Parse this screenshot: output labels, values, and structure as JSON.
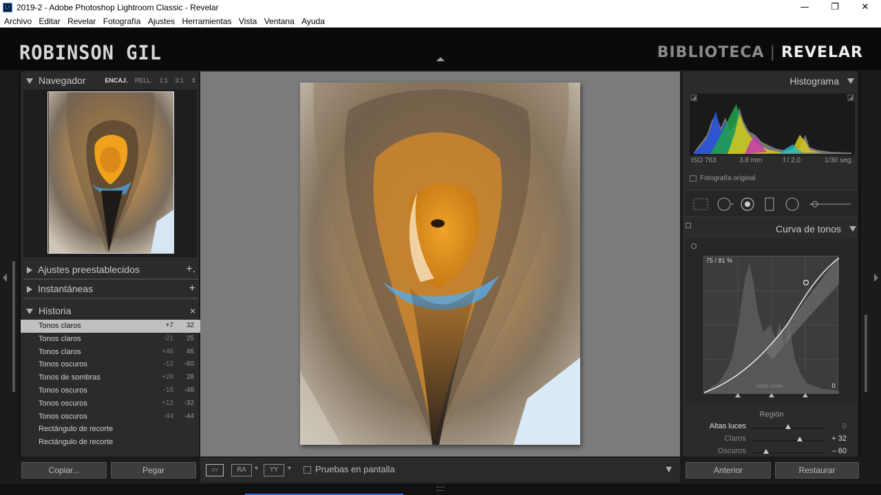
{
  "window": {
    "title": "2019-2 - Adobe Photoshop Lightroom Classic - Revelar",
    "app_icon": "Lr",
    "minimize": "—",
    "maximize": "❐",
    "close": "✕"
  },
  "menu": [
    "Archivo",
    "Editar",
    "Revelar",
    "Fotografía",
    "Ajustes",
    "Herramientas",
    "Vista",
    "Ventana",
    "Ayuda"
  ],
  "identity": {
    "brand": "ROBINSON GIL",
    "modules": {
      "library": "BIBLIOTECA",
      "separator": "|",
      "develop": "REVELAR"
    }
  },
  "navigator": {
    "title": "Navegador",
    "zoom": [
      "ENCAJ.",
      "RELL.",
      "1:1",
      "3:1"
    ],
    "zoom_arrow": "⇕"
  },
  "left_panels": {
    "presets": {
      "title": "Ajustes preestablecidos",
      "action": "+."
    },
    "snapshots": {
      "title": "Instantáneas",
      "action": "+"
    },
    "history": {
      "title": "Historia",
      "action": "×"
    }
  },
  "history": [
    {
      "name": "Tonos claros",
      "delta": "+7",
      "value": "32",
      "selected": true
    },
    {
      "name": "Tonos claros",
      "delta": "-21",
      "value": "25"
    },
    {
      "name": "Tonos claros",
      "delta": "+46",
      "value": "46"
    },
    {
      "name": "Tonos oscuros",
      "delta": "-12",
      "value": "-60"
    },
    {
      "name": "Tonos de sombras",
      "delta": "+28",
      "value": "28"
    },
    {
      "name": "Tonos oscuros",
      "delta": "-16",
      "value": "-48"
    },
    {
      "name": "Tonos oscuros",
      "delta": "+12",
      "value": "-32"
    },
    {
      "name": "Tonos oscuros",
      "delta": "-44",
      "value": "-44"
    },
    {
      "name": "Rectángulo de recorte",
      "delta": "",
      "value": ""
    },
    {
      "name": "Rectángulo de recorte",
      "delta": "",
      "value": ""
    }
  ],
  "left_buttons": {
    "copy": "Copiar...",
    "paste": "Pegar"
  },
  "toolbar": {
    "view_icon": "▭",
    "ra_icon": "RA",
    "yy_icon": "YY",
    "dropdown": "▾",
    "softproof": "Pruebas en pantalla",
    "menu_arrow": "▼"
  },
  "histogram": {
    "title": "Histograma",
    "iso": "ISO 763",
    "focal": "3.8 mm",
    "aperture": "f / 2,0",
    "shutter": "1/30 seg.",
    "original_photo": "Fotografía original"
  },
  "tone_curve": {
    "title": "Curva de tonos",
    "readout": "75 / 81 %",
    "region_name": "Altas luces",
    "region_value": "0",
    "region_label": "Región",
    "sliders": [
      {
        "label": "Altas luces",
        "value": "0",
        "level": 0.5
      },
      {
        "label": "Claros",
        "value": "+ 32",
        "level": 0.66
      },
      {
        "label": "Oscuros",
        "value": "– 60",
        "level": 0.2
      }
    ]
  },
  "right_buttons": {
    "previous": "Anterior",
    "reset": "Restaurar"
  }
}
